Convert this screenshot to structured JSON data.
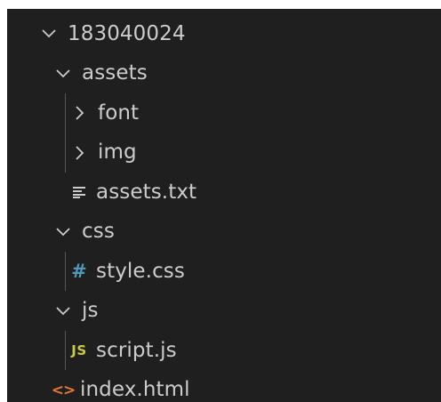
{
  "explorer": {
    "items": [
      {
        "label": "183040024",
        "kind": "folder",
        "expanded": true,
        "depth": 0
      },
      {
        "label": "assets",
        "kind": "folder",
        "expanded": true,
        "depth": 1
      },
      {
        "label": "font",
        "kind": "folder",
        "expanded": false,
        "depth": 2
      },
      {
        "label": "img",
        "kind": "folder",
        "expanded": false,
        "depth": 2
      },
      {
        "label": "assets.txt",
        "kind": "file",
        "icon": "text-file-icon",
        "depth": 2
      },
      {
        "label": "css",
        "kind": "folder",
        "expanded": true,
        "depth": 1
      },
      {
        "label": "style.css",
        "kind": "file",
        "icon": "css-file-icon",
        "icon_text": "#",
        "depth": 2
      },
      {
        "label": "js",
        "kind": "folder",
        "expanded": true,
        "depth": 1
      },
      {
        "label": "script.js",
        "kind": "file",
        "icon": "js-file-icon",
        "icon_text": "JS",
        "depth": 2
      },
      {
        "label": "index.html",
        "kind": "file",
        "icon": "html-file-icon",
        "icon_text": "<>",
        "depth": 1
      }
    ]
  },
  "colors": {
    "background": "#1f1f1f",
    "text": "#cccccc",
    "css_icon": "#519aba",
    "js_icon": "#cbcb41",
    "html_icon": "#e37933",
    "indent_guide": "#585858"
  }
}
